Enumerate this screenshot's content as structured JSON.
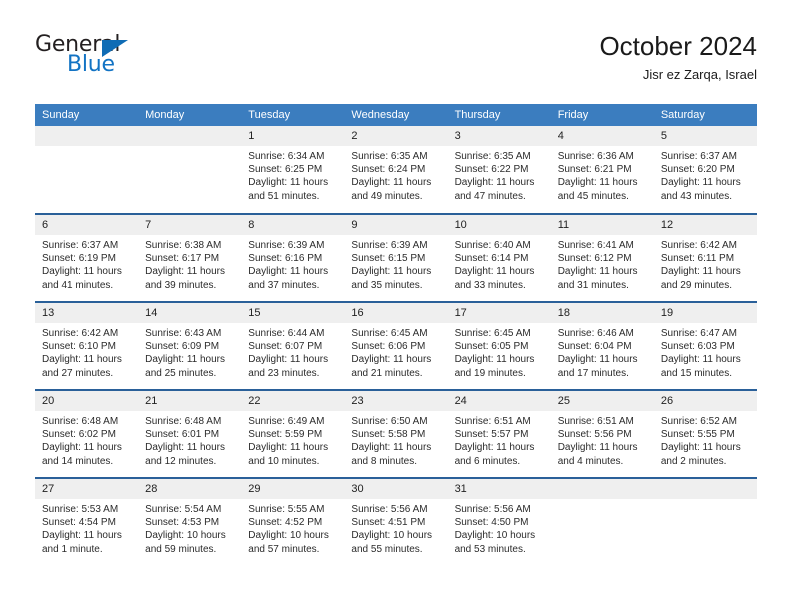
{
  "brand": {
    "line1": "General",
    "line2": "Blue",
    "triangle_color": "#0f6cb5",
    "text_color": "#231f20",
    "blue_color": "#1273c4"
  },
  "header": {
    "title": "October 2024",
    "subtitle": "Jisr ez Zarqa, Israel"
  },
  "theme": {
    "header_bg": "#3b7dbf",
    "row_divider": "#2a6099",
    "daynum_bg": "#efefef"
  },
  "weekday_headers": [
    "Sunday",
    "Monday",
    "Tuesday",
    "Wednesday",
    "Thursday",
    "Friday",
    "Saturday"
  ],
  "weeks": [
    [
      {
        "day": "",
        "lines": []
      },
      {
        "day": "",
        "lines": []
      },
      {
        "day": "1",
        "lines": [
          "Sunrise: 6:34 AM",
          "Sunset: 6:25 PM",
          "Daylight: 11 hours and 51 minutes."
        ]
      },
      {
        "day": "2",
        "lines": [
          "Sunrise: 6:35 AM",
          "Sunset: 6:24 PM",
          "Daylight: 11 hours and 49 minutes."
        ]
      },
      {
        "day": "3",
        "lines": [
          "Sunrise: 6:35 AM",
          "Sunset: 6:22 PM",
          "Daylight: 11 hours and 47 minutes."
        ]
      },
      {
        "day": "4",
        "lines": [
          "Sunrise: 6:36 AM",
          "Sunset: 6:21 PM",
          "Daylight: 11 hours and 45 minutes."
        ]
      },
      {
        "day": "5",
        "lines": [
          "Sunrise: 6:37 AM",
          "Sunset: 6:20 PM",
          "Daylight: 11 hours and 43 minutes."
        ]
      }
    ],
    [
      {
        "day": "6",
        "lines": [
          "Sunrise: 6:37 AM",
          "Sunset: 6:19 PM",
          "Daylight: 11 hours and 41 minutes."
        ]
      },
      {
        "day": "7",
        "lines": [
          "Sunrise: 6:38 AM",
          "Sunset: 6:17 PM",
          "Daylight: 11 hours and 39 minutes."
        ]
      },
      {
        "day": "8",
        "lines": [
          "Sunrise: 6:39 AM",
          "Sunset: 6:16 PM",
          "Daylight: 11 hours and 37 minutes."
        ]
      },
      {
        "day": "9",
        "lines": [
          "Sunrise: 6:39 AM",
          "Sunset: 6:15 PM",
          "Daylight: 11 hours and 35 minutes."
        ]
      },
      {
        "day": "10",
        "lines": [
          "Sunrise: 6:40 AM",
          "Sunset: 6:14 PM",
          "Daylight: 11 hours and 33 minutes."
        ]
      },
      {
        "day": "11",
        "lines": [
          "Sunrise: 6:41 AM",
          "Sunset: 6:12 PM",
          "Daylight: 11 hours and 31 minutes."
        ]
      },
      {
        "day": "12",
        "lines": [
          "Sunrise: 6:42 AM",
          "Sunset: 6:11 PM",
          "Daylight: 11 hours and 29 minutes."
        ]
      }
    ],
    [
      {
        "day": "13",
        "lines": [
          "Sunrise: 6:42 AM",
          "Sunset: 6:10 PM",
          "Daylight: 11 hours and 27 minutes."
        ]
      },
      {
        "day": "14",
        "lines": [
          "Sunrise: 6:43 AM",
          "Sunset: 6:09 PM",
          "Daylight: 11 hours and 25 minutes."
        ]
      },
      {
        "day": "15",
        "lines": [
          "Sunrise: 6:44 AM",
          "Sunset: 6:07 PM",
          "Daylight: 11 hours and 23 minutes."
        ]
      },
      {
        "day": "16",
        "lines": [
          "Sunrise: 6:45 AM",
          "Sunset: 6:06 PM",
          "Daylight: 11 hours and 21 minutes."
        ]
      },
      {
        "day": "17",
        "lines": [
          "Sunrise: 6:45 AM",
          "Sunset: 6:05 PM",
          "Daylight: 11 hours and 19 minutes."
        ]
      },
      {
        "day": "18",
        "lines": [
          "Sunrise: 6:46 AM",
          "Sunset: 6:04 PM",
          "Daylight: 11 hours and 17 minutes."
        ]
      },
      {
        "day": "19",
        "lines": [
          "Sunrise: 6:47 AM",
          "Sunset: 6:03 PM",
          "Daylight: 11 hours and 15 minutes."
        ]
      }
    ],
    [
      {
        "day": "20",
        "lines": [
          "Sunrise: 6:48 AM",
          "Sunset: 6:02 PM",
          "Daylight: 11 hours and 14 minutes."
        ]
      },
      {
        "day": "21",
        "lines": [
          "Sunrise: 6:48 AM",
          "Sunset: 6:01 PM",
          "Daylight: 11 hours and 12 minutes."
        ]
      },
      {
        "day": "22",
        "lines": [
          "Sunrise: 6:49 AM",
          "Sunset: 5:59 PM",
          "Daylight: 11 hours and 10 minutes."
        ]
      },
      {
        "day": "23",
        "lines": [
          "Sunrise: 6:50 AM",
          "Sunset: 5:58 PM",
          "Daylight: 11 hours and 8 minutes."
        ]
      },
      {
        "day": "24",
        "lines": [
          "Sunrise: 6:51 AM",
          "Sunset: 5:57 PM",
          "Daylight: 11 hours and 6 minutes."
        ]
      },
      {
        "day": "25",
        "lines": [
          "Sunrise: 6:51 AM",
          "Sunset: 5:56 PM",
          "Daylight: 11 hours and 4 minutes."
        ]
      },
      {
        "day": "26",
        "lines": [
          "Sunrise: 6:52 AM",
          "Sunset: 5:55 PM",
          "Daylight: 11 hours and 2 minutes."
        ]
      }
    ],
    [
      {
        "day": "27",
        "lines": [
          "Sunrise: 5:53 AM",
          "Sunset: 4:54 PM",
          "Daylight: 11 hours and 1 minute."
        ]
      },
      {
        "day": "28",
        "lines": [
          "Sunrise: 5:54 AM",
          "Sunset: 4:53 PM",
          "Daylight: 10 hours and 59 minutes."
        ]
      },
      {
        "day": "29",
        "lines": [
          "Sunrise: 5:55 AM",
          "Sunset: 4:52 PM",
          "Daylight: 10 hours and 57 minutes."
        ]
      },
      {
        "day": "30",
        "lines": [
          "Sunrise: 5:56 AM",
          "Sunset: 4:51 PM",
          "Daylight: 10 hours and 55 minutes."
        ]
      },
      {
        "day": "31",
        "lines": [
          "Sunrise: 5:56 AM",
          "Sunset: 4:50 PM",
          "Daylight: 10 hours and 53 minutes."
        ]
      },
      {
        "day": "",
        "lines": []
      },
      {
        "day": "",
        "lines": []
      }
    ]
  ]
}
